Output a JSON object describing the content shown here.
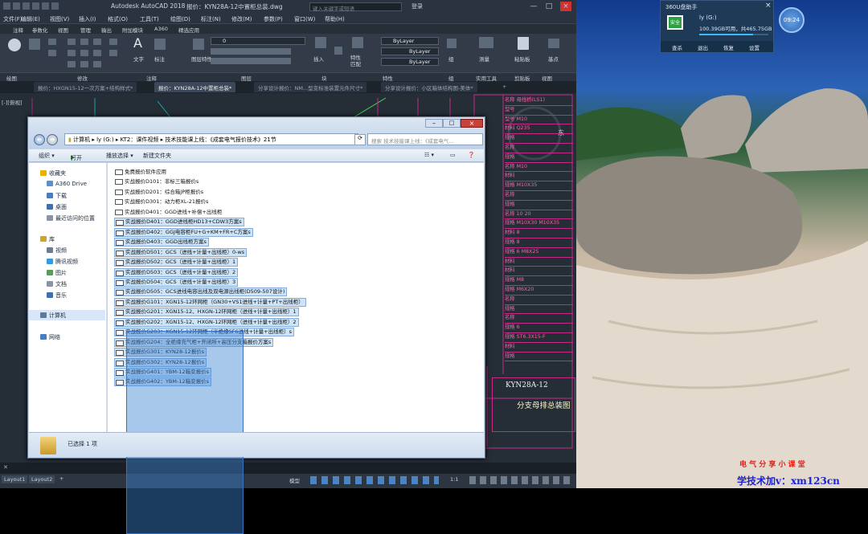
{
  "cad": {
    "app_title": "Autodesk AutoCAD 2018",
    "doc_title": "报价：KYN28A-12中置柜总装.dwg",
    "search_placeholder": "键入关键字或短语",
    "login": "登录",
    "menu": [
      "文件(F)",
      "编辑(E)",
      "视图(V)",
      "插入(I)",
      "格式(O)",
      "工具(T)",
      "绘图(D)",
      "标注(N)",
      "修改(M)",
      "参数(P)",
      "窗口(W)",
      "帮助(H)"
    ],
    "ribbon_tabs": [
      "注释",
      "参数化",
      "视图",
      "管理",
      "输出",
      "附加模块",
      "A360",
      "精选应用"
    ],
    "ribbon": {
      "text": "文字",
      "dim": "标注",
      "layer": "图层特性",
      "layer_value": "0",
      "insert": "插入",
      "match": "特性匹配",
      "bylayer1": "ByLayer",
      "bylayer2": "ByLayer",
      "bylayer3": "ByLayer",
      "group": "组",
      "measure": "测量",
      "paste": "粘贴板",
      "base": "基点"
    },
    "panels": [
      "绘图",
      "修改",
      "注释",
      "图层",
      "块",
      "特性",
      "组",
      "实用工具",
      "剪贴板",
      "视图"
    ],
    "doc_tabs": [
      "报价：HXGN15-12一次方案+结构样式*",
      "报价：KYN28A-12中置柜总装*",
      "分享设计报价：NM...型变标准装置元件尺寸*",
      "分享设计报价：小区箱体结构图-美体*"
    ],
    "side_label": "[-][俯视]",
    "layout_tabs": [
      "Layout1",
      "Layout2"
    ],
    "status_model": "模型",
    "status_scale": "1:1",
    "titleblock_rows": [
      "名称 母线桥(LS1)",
      "型号",
      "型号 M10",
      "材料 Q235",
      "规格",
      "名称",
      "规格",
      "名称 M10",
      "材料",
      "规格 M10X35",
      "名称",
      "规格",
      "名称 10 20",
      "规格 M10X30 M10X35",
      "材料 8",
      "规格 8",
      "规格 6 M8X25",
      "材料",
      "材料",
      "规格 M8",
      "规格 M6X20",
      "名称",
      "规格",
      "名称",
      "规格 6",
      "规格 ST6.3X15-F",
      "材料",
      "规格"
    ],
    "drawing_code": "KYN28A-12",
    "drawing_name": "分支母排总装图"
  },
  "explorer": {
    "path_root": "计算机",
    "path_drive": "ly (G:)",
    "path_folder": "KT2：课件视频",
    "path_sub": "技术技能课上线：《成套电气报价技术》21节",
    "search_placeholder": "搜索 技术技能课上线：《成套电气...",
    "toolbar": {
      "organize": "组织 ▾",
      "open": "打开",
      "share": "播放选择 ▾",
      "new_folder": "新建文件夹"
    },
    "nav": {
      "favorites": "收藏夹",
      "a360": "A360 Drive",
      "downloads": "下载",
      "desktop": "桌面",
      "recent": "最近访问的位置",
      "libraries": "库",
      "videos": "视频",
      "tencent": "腾讯视频",
      "pictures": "图片",
      "documents": "文档",
      "music": "音乐",
      "computer": "计算机",
      "network": "网络"
    },
    "files": [
      "免费报价软件应用",
      "实战报价D101：非标三箱报价s",
      "实战报价D201：综合箱JP柜报价s",
      "实战报价D301：动力柜XL-21报价s",
      "实战报价D401：GGD进线+补偿+出线柜",
      "实战报价D401：GGD进线柜HD13+CDW3方案s",
      "实战报价D402：GGJ电容柜FU+G+KM+FR+C方案s",
      "实战报价D403：GGD出线柜方案s",
      "实战报价D501：GCS（进线+计量+出线柜）0-ws",
      "实战报价D502：GCS（进线+计量+出线柜）1",
      "实战报价D503：GCS（进线+计量+出线柜）2",
      "实战报价D504：GCS（进线+计量+出线柜）3",
      "实战报价D505：GCS进线电容出线及双电源出线柜(D509-507设计)",
      "实战报价G101：XGN15-12环网柜（GN30+VS1进线+计量+PT+出线柜）",
      "实战报价G201：XGN15-12、HXGN-12环网柜（进线+计量+出线柜）1",
      "实战报价G202：XGN15-12、HXGN-12环网柜（进线+计量+出线柜）2",
      "实战报价G203：XGN15-12环网柜（半绝缘SF6进线+计量+出线柜）s",
      "实战报价G204：全绝缘充气柜+开闭所+高压分支箱报价方案s",
      "实战报价G301：KYN28-12报价s",
      "实战报价G302：KYN28-12报价s",
      "实战报价G401：YBM-12箱变报价s",
      "实战报价G402：YBM-12箱变报价s"
    ],
    "status": "已选择 1 项"
  },
  "desktop": {
    "widget_title": "360U盘助手",
    "widget_drive": "ly (G:)",
    "widget_size": "100.39GB可用，共465.75GB",
    "widget_safe": "安全",
    "widget_actions": [
      "查杀",
      "退出",
      "恢复",
      "设置"
    ],
    "clock": "09:24",
    "footer_red": "电 气 分 享 小 课 堂",
    "footer_blue": "学技术加v：xm123cn"
  }
}
